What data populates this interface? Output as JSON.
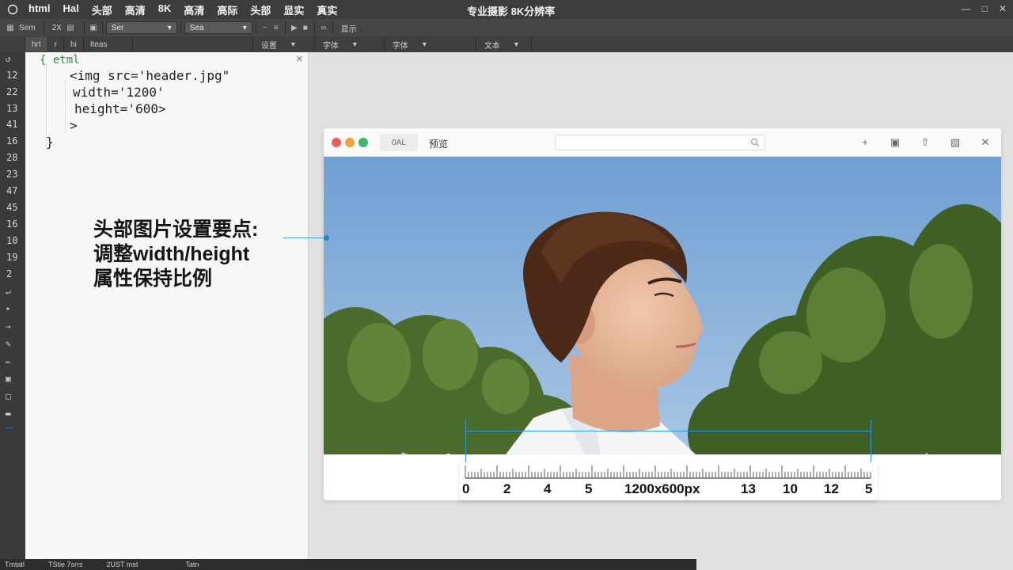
{
  "menubar": {
    "items": [
      "html",
      "Hal",
      "头部",
      "高清",
      "8K",
      "高清",
      "高际",
      "头部",
      "显实",
      "真实"
    ],
    "title": "专业摄影 8K分辨率"
  },
  "toolbar": {
    "label_1": "Sem",
    "label_2": "2X",
    "select_1": "Ser",
    "select_2": "Sea",
    "label_3": "显示"
  },
  "tabbar": {
    "tabs": [
      "hrt",
      "r",
      "hi",
      "Iteas"
    ],
    "drop_1": "设置",
    "drop_2": "字体",
    "drop_3": "字体",
    "drop_4": "文本"
  },
  "gutter": {
    "line_numbers": [
      "12",
      "22",
      "13",
      "41",
      "16",
      "28",
      "23",
      "47",
      "45",
      "16",
      "10",
      "19",
      "2"
    ]
  },
  "editor": {
    "line_open": "{ etml",
    "line_img": "<img src='header.jpg\"",
    "line_width": "width='1200'",
    "line_height": "height='600>",
    "line_gt": ">",
    "line_close": "}",
    "note_line1": "头部图片设置要点:",
    "note_line2": "调整width/height",
    "note_line3": "属性保持比例"
  },
  "browser": {
    "tab_label": "0AL",
    "tab2_label": "预览"
  },
  "ruler": {
    "labels": [
      "0",
      "2",
      "4",
      "5",
      "13",
      "10",
      "12",
      "5"
    ],
    "dimension": "1200x600px"
  },
  "statusbar": {
    "items": [
      "Tmtatl",
      "TStie 7srrs",
      "2UST mst",
      "Tatn"
    ]
  },
  "colors": {
    "accent": "#2c9ad8",
    "traffic_red": "#ec5f57",
    "traffic_yellow": "#f0a13a",
    "traffic_green": "#3bb86c"
  }
}
